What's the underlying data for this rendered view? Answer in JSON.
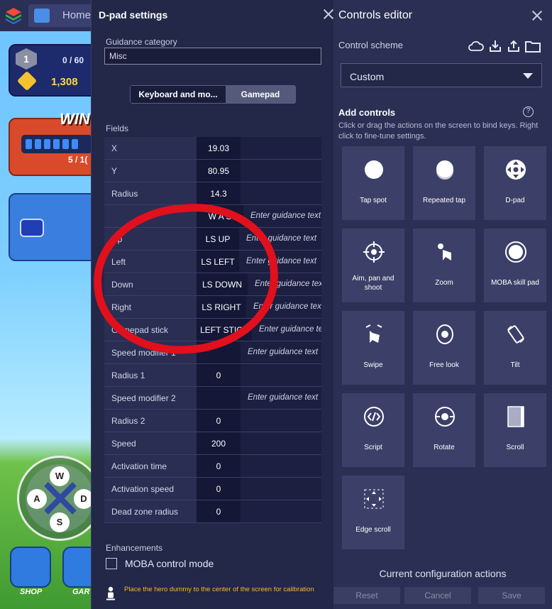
{
  "game": {
    "home_tab": "Home",
    "xp": "0 / 60",
    "level": "1",
    "coins": "1,308",
    "win_label": "WIN",
    "win_count": "5 / 1(",
    "joystick": {
      "up": "W",
      "left": "A",
      "right": "D",
      "down": "S"
    },
    "shop_label": "SHOP",
    "garage_label": "GAR"
  },
  "dpad_settings": {
    "title": "D-pad settings",
    "guidance_category_label": "Guidance category",
    "guidance_category_value": "Misc",
    "tabs": [
      {
        "label": "Keyboard and mo..."
      },
      {
        "label": "Gamepad"
      }
    ],
    "fields_label": "Fields",
    "fields": [
      {
        "name": "X",
        "value": "19.03",
        "hint": ""
      },
      {
        "name": "Y",
        "value": "80.95",
        "hint": ""
      },
      {
        "name": "Radius",
        "value": "14.3",
        "hint": ""
      },
      {
        "name": "",
        "value": "W A S",
        "hint": "Enter guidance text"
      },
      {
        "name": "Up",
        "value": "LS UP",
        "hint": "Enter guidance text"
      },
      {
        "name": "Left",
        "value": "LS LEFT",
        "hint": "Enter guidance text"
      },
      {
        "name": "Down",
        "value": "LS DOWN",
        "hint": "Enter guidance tex"
      },
      {
        "name": "Right",
        "value": "LS RIGHT",
        "hint": "Enter guidance text"
      },
      {
        "name": "Gamepad stick",
        "value": "LEFT STICK",
        "hint": "Enter guidance te"
      },
      {
        "name": "Speed modifier 1",
        "value": "",
        "hint": "Enter guidance text"
      },
      {
        "name": "Radius 1",
        "value": "0",
        "hint": ""
      },
      {
        "name": "Speed modifier 2",
        "value": "",
        "hint": "Enter guidance text"
      },
      {
        "name": "Radius 2",
        "value": "0",
        "hint": ""
      },
      {
        "name": "Speed",
        "value": "200",
        "hint": ""
      },
      {
        "name": "Activation time",
        "value": "0",
        "hint": ""
      },
      {
        "name": "Activation speed",
        "value": "0",
        "hint": ""
      },
      {
        "name": "Dead zone radius",
        "value": "0",
        "hint": ""
      }
    ],
    "enhancements_label": "Enhancements",
    "moba_label": "MOBA control mode",
    "moba_checked": false,
    "hero_hint": "Place the hero dummy to the center of the screen for calibration"
  },
  "controls_editor": {
    "title": "Controls editor",
    "scheme_label": "Control scheme",
    "scheme_value": "Custom",
    "add_controls_title": "Add controls",
    "add_controls_desc": "Click or drag the actions on the screen to bind keys. Right click to fine-tune settings.",
    "controls": [
      {
        "label": "Tap spot",
        "icon": "tap-spot-icon"
      },
      {
        "label": "Repeated tap",
        "icon": "repeated-tap-icon"
      },
      {
        "label": "D-pad",
        "icon": "dpad-icon"
      },
      {
        "label": "Aim, pan and shoot",
        "icon": "crosshair-icon"
      },
      {
        "label": "Zoom",
        "icon": "zoom-icon"
      },
      {
        "label": "MOBA skill pad",
        "icon": "moba-skill-pad-icon"
      },
      {
        "label": "Swipe",
        "icon": "swipe-icon"
      },
      {
        "label": "Free look",
        "icon": "eye-icon"
      },
      {
        "label": "Tilt",
        "icon": "tilt-icon"
      },
      {
        "label": "Script",
        "icon": "script-icon"
      },
      {
        "label": "Rotate",
        "icon": "rotate-icon"
      },
      {
        "label": "Scroll",
        "icon": "scroll-icon"
      },
      {
        "label": "Edge scroll",
        "icon": "edge-scroll-icon"
      }
    ],
    "config_title": "Current configuration actions",
    "buttons": {
      "reset": "Reset",
      "cancel": "Cancel",
      "save": "Save"
    }
  }
}
